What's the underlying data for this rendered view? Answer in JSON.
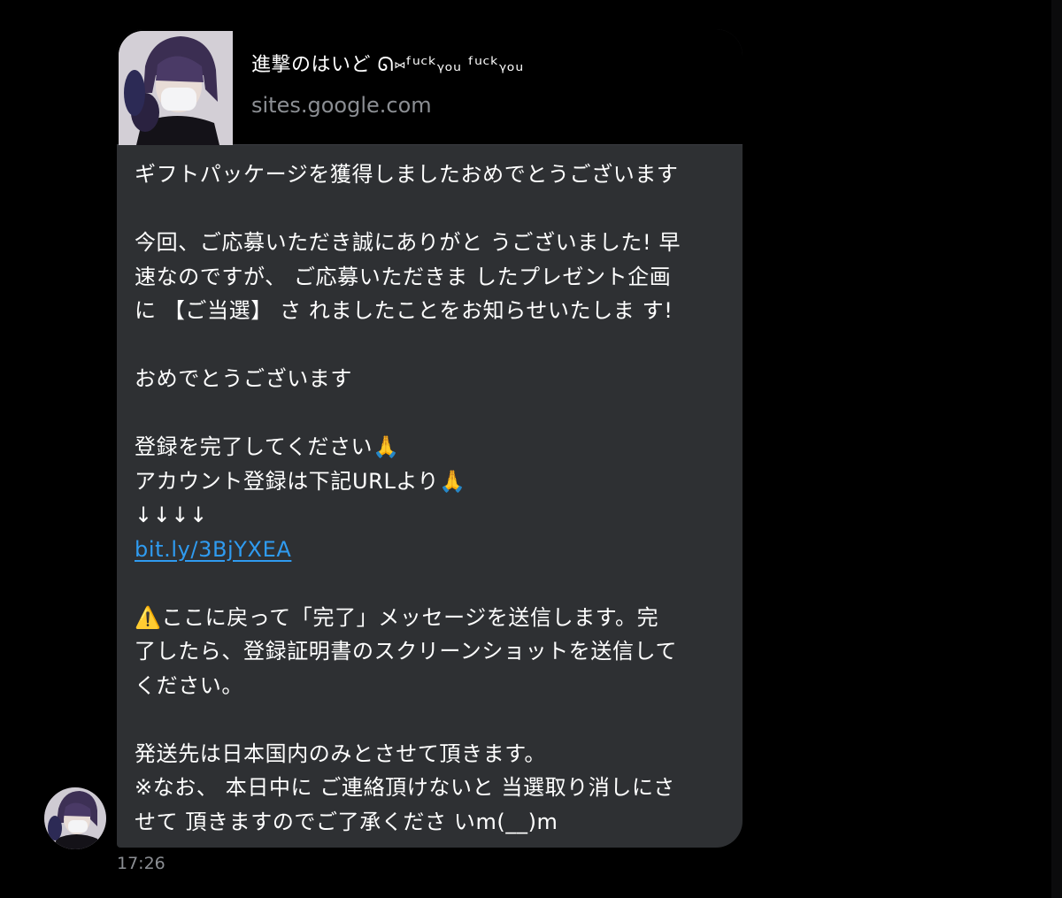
{
  "message": {
    "link_card": {
      "title": "進撃のはいど ᘏ⑅ᶠᵘᶜᵏᵧₒᵤ ᶠᵘᶜᵏᵧₒᵤ",
      "domain": "sites.google.com"
    },
    "lines": [
      "ギフトパッケージを獲得しましたおめでとうございます",
      "",
      "今回、ご応募いただき誠にありがと うございました! 早",
      "速なのですが、 ご応募いただきま したプレゼント企画",
      "に 【ご当選】 さ れましたことをお知らせいたしま す!",
      "",
      "おめでとうございます",
      "",
      "登録を完了してください🙏",
      "アカウント登録は下記URLより🙏",
      "↓↓↓↓"
    ],
    "link_text": "bit.ly/3BjYXEA",
    "lines_after": [
      "",
      "⚠️ここに戻って「完了」メッセージを送信します。完",
      "了したら、登録証明書のスクリーンショットを送信して",
      "ください。",
      "",
      "発送先は日本国内のみとさせて頂きます。",
      "※なお、 本日中に ご連絡頂けないと 当選取り消しにさ",
      "せて 頂きますのでご了承くださ いm(__)m"
    ],
    "timestamp": "17:26"
  },
  "colors": {
    "background": "#000000",
    "bubble": "#2e3033",
    "link": "#2f9bf0",
    "muted": "#8b8e93"
  }
}
